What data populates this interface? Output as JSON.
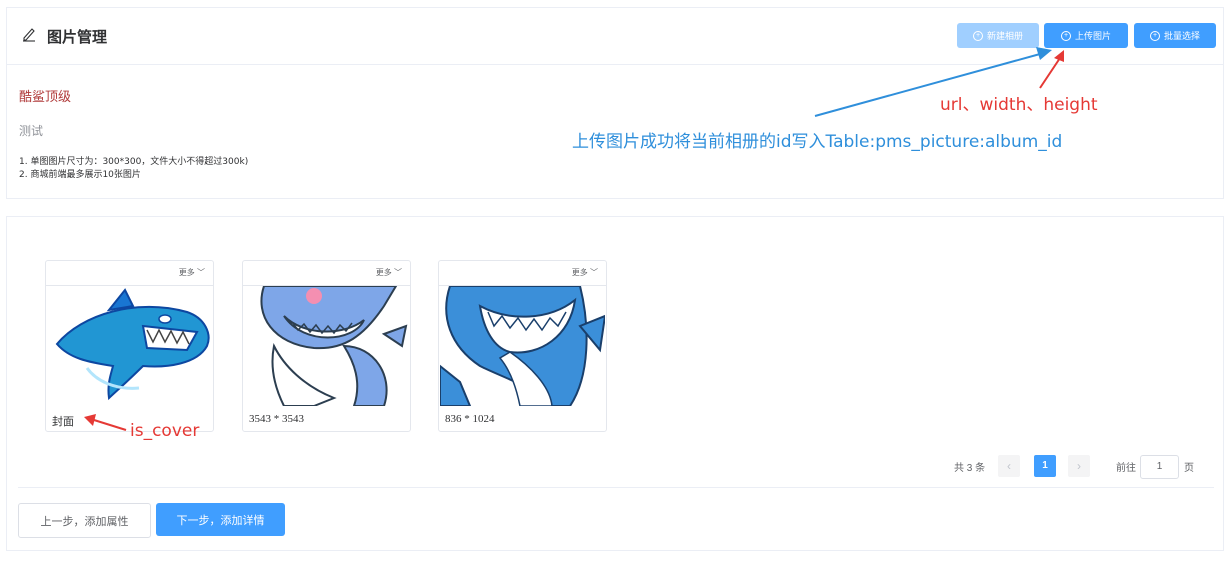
{
  "header": {
    "title": "图片管理",
    "buttons": {
      "new_album": "新建相册",
      "upload": "上传图片",
      "batch": "批量选择"
    }
  },
  "album": {
    "name": "酷鲨顶级",
    "description": "测试",
    "tips": [
      "1. 单图图片尺寸为：300*300，文件大小不得超过300k)",
      "2. 商城前端最多展示10张图片"
    ]
  },
  "annotations": {
    "fields": "url、width、height",
    "upload_note": "上传图片成功将当前相册的id写入Table:pms_picture:album_id",
    "cover_field": "is_cover"
  },
  "pictures": [
    {
      "more": "更多",
      "label": "封面"
    },
    {
      "more": "更多",
      "label": "3543 * 3543"
    },
    {
      "more": "更多",
      "label": "836 * 1024"
    }
  ],
  "pagination": {
    "total": "共 3 条",
    "current": "1",
    "goto_label": "前往",
    "goto_value": "1",
    "page_unit": "页"
  },
  "footer": {
    "prev": "上一步，添加属性",
    "next": "下一步，添加详情"
  },
  "colors": {
    "primary": "#409eff",
    "primary_disabled": "#a0cfff",
    "annotation_red": "#e53935",
    "annotation_blue": "#2f8fdb"
  }
}
